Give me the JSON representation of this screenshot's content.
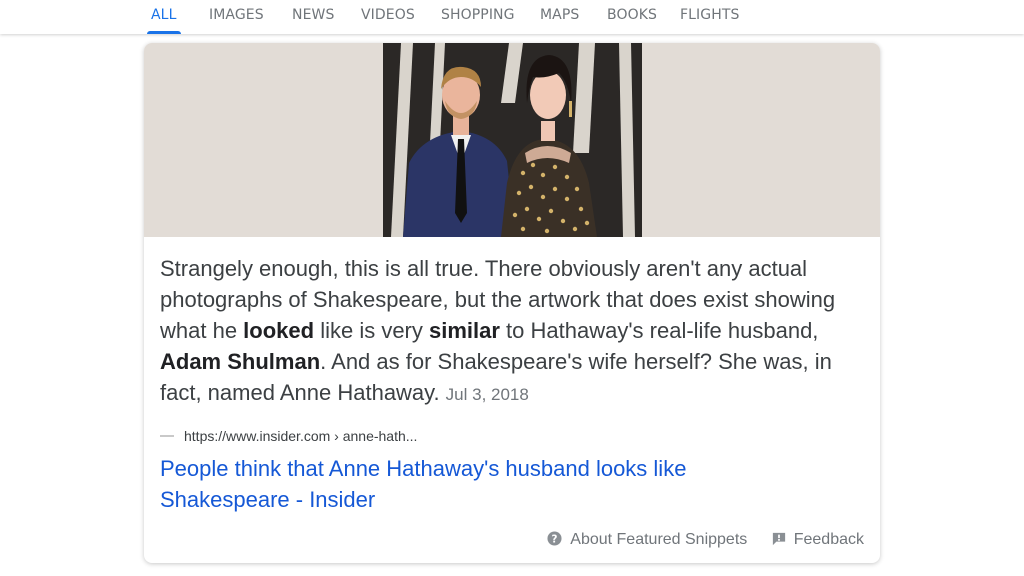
{
  "tabs": [
    {
      "label": "ALL",
      "active": true
    },
    {
      "label": "IMAGES",
      "active": false
    },
    {
      "label": "NEWS",
      "active": false
    },
    {
      "label": "VIDEOS",
      "active": false
    },
    {
      "label": "SHOPPING",
      "active": false
    },
    {
      "label": "MAPS",
      "active": false
    },
    {
      "label": "BOOKS",
      "active": false
    },
    {
      "label": "FLIGHTS",
      "active": false
    }
  ],
  "snippet": {
    "part1": "Strangely enough, this is all true. There obviously aren't any actual photographs of Shakespeare, but the artwork that does exist showing what he ",
    "bold1": "looked",
    "part2": " like is very ",
    "bold2": "similar",
    "part3": " to Hathaway's real-life husband, ",
    "bold3": "Adam Shulman",
    "part4": ". And as for Shakespeare's wife herself? She was, in fact, named Anne Hathaway.",
    "date": "Jul 3, 2018"
  },
  "source": {
    "url": "https://www.insider.com › anne-hath..."
  },
  "result": {
    "title": "People think that Anne Hathaway's husband looks like Shakespeare - Insider"
  },
  "footer": {
    "about_label": "About Featured Snippets",
    "feedback_label": "Feedback"
  },
  "colors": {
    "accent": "#1a73e8",
    "link": "#1558d6",
    "text": "#3c4043",
    "muted": "#70757a"
  },
  "icons": {
    "about": "help-circle-icon",
    "feedback": "feedback-flag-icon"
  }
}
